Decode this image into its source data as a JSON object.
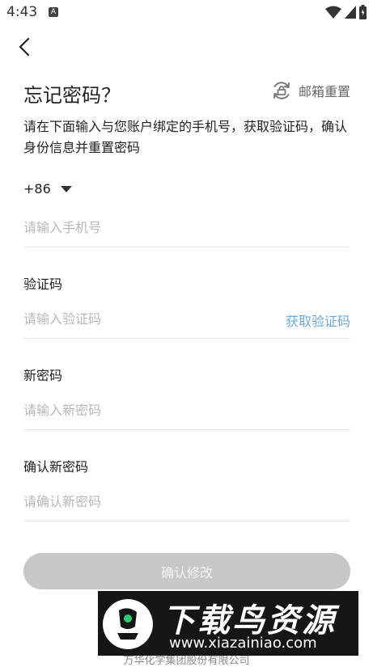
{
  "status_bar": {
    "time": "4:43",
    "notification_badge": "A"
  },
  "header": {
    "title": "忘记密码？",
    "email_reset_label": "邮箱重置",
    "description": "请在下面输入与您账户绑定的手机号，获取验证码，确认身份信息并重置密码"
  },
  "phone": {
    "country_code": "+86",
    "placeholder": "请输入手机号"
  },
  "verification": {
    "label": "验证码",
    "placeholder": "请输入验证码",
    "get_code_label": "获取验证码"
  },
  "new_password": {
    "label": "新密码",
    "placeholder": "请输入新密码"
  },
  "confirm_password": {
    "label": "确认新密码",
    "placeholder": "请确认新密码"
  },
  "submit": {
    "label": "确认修改"
  },
  "watermark": {
    "title": "下载鸟资源",
    "url": "www.xiazainiao.com"
  },
  "footer": {
    "company": "万华化学集团股份有限公司"
  },
  "colors": {
    "link": "#6aa9e0",
    "button_disabled": "#c7c7c7",
    "placeholder": "#b8b8b8"
  }
}
